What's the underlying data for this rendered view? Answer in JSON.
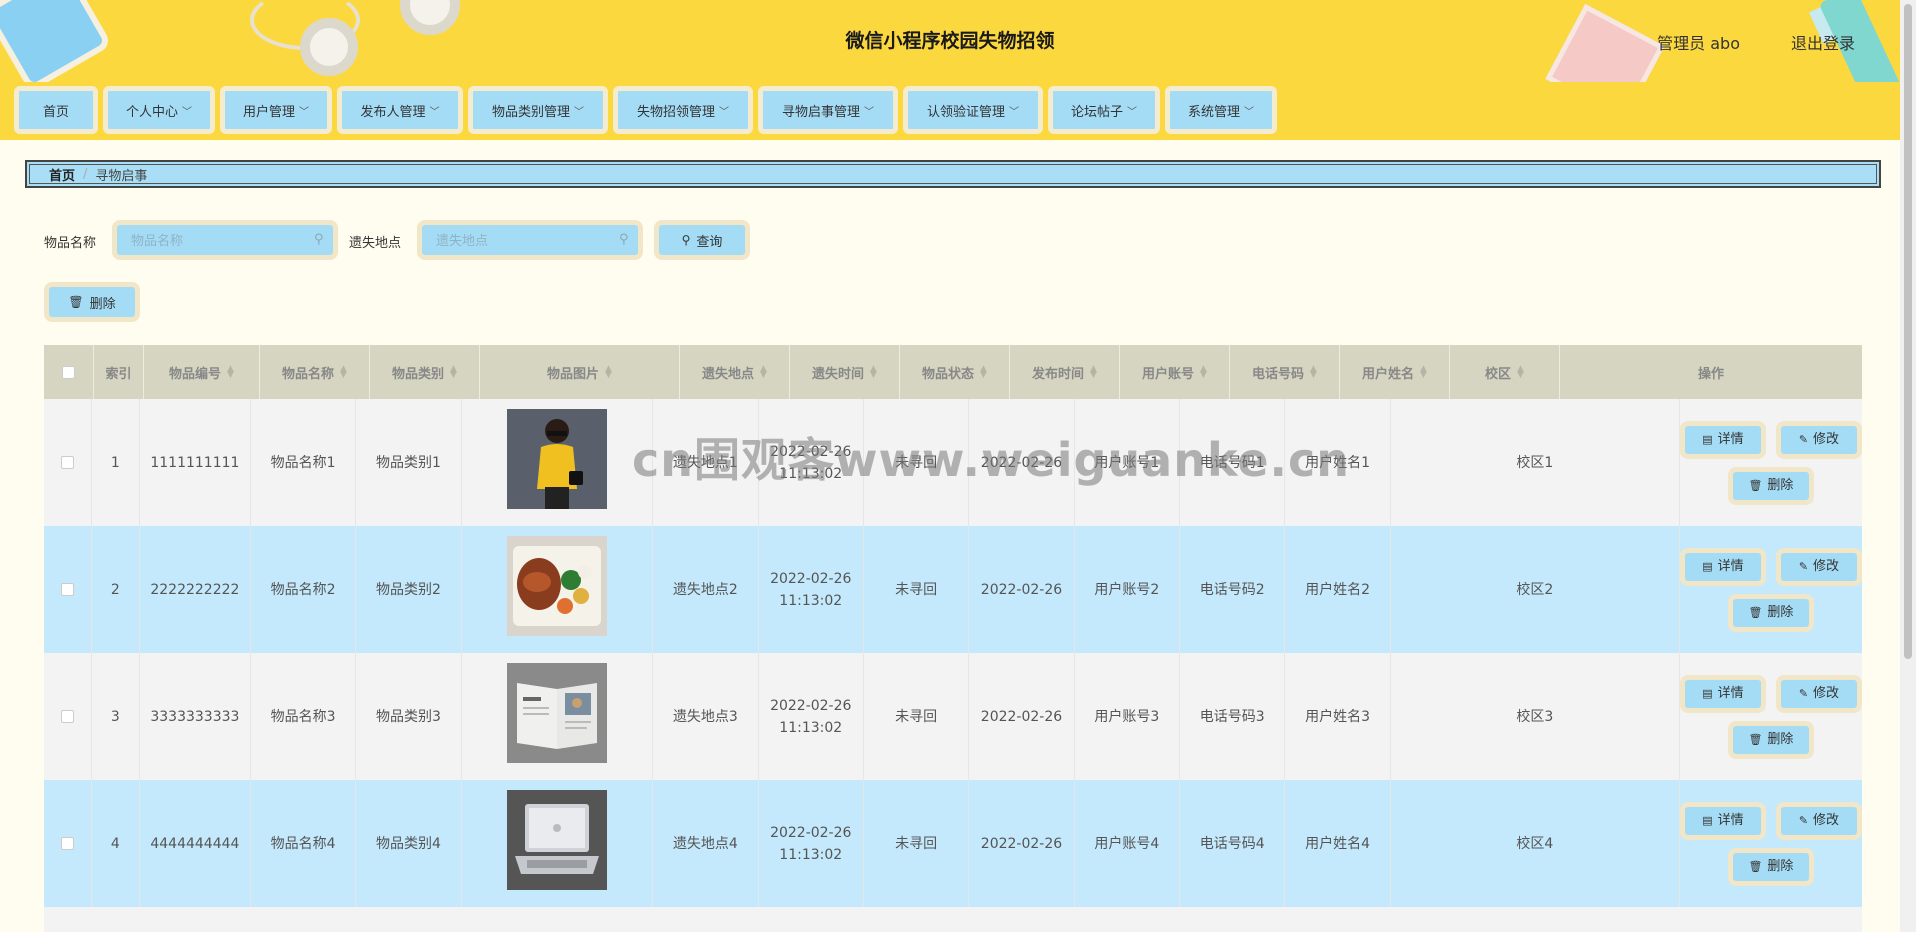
{
  "header": {
    "title": "微信小程序校园失物招领",
    "admin_label": "管理员 abo",
    "logout_label": "退出登录"
  },
  "nav": {
    "items": [
      {
        "label": "首页",
        "dropdown": false
      },
      {
        "label": "个人中心",
        "dropdown": true
      },
      {
        "label": "用户管理",
        "dropdown": true
      },
      {
        "label": "发布人管理",
        "dropdown": true
      },
      {
        "label": "物品类别管理",
        "dropdown": true
      },
      {
        "label": "失物招领管理",
        "dropdown": true
      },
      {
        "label": "寻物启事管理",
        "dropdown": true
      },
      {
        "label": "认领验证管理",
        "dropdown": true
      },
      {
        "label": "论坛帖子",
        "dropdown": true
      },
      {
        "label": "系统管理",
        "dropdown": true
      }
    ]
  },
  "breadcrumb": {
    "home": "首页",
    "separator": "/",
    "current": "寻物启事"
  },
  "search": {
    "name_label": "物品名称",
    "name_placeholder": "物品名称",
    "place_label": "遗失地点",
    "place_placeholder": "遗失地点",
    "query_label": "查询",
    "delete_label": "删除"
  },
  "table": {
    "columns": [
      "索引",
      "物品编号",
      "物品名称",
      "物品类别",
      "物品图片",
      "遗失地点",
      "遗失时间",
      "物品状态",
      "发布时间",
      "用户账号",
      "电话号码",
      "用户姓名",
      "校区",
      "操作"
    ],
    "rows": [
      {
        "index": "1",
        "code": "1111111111",
        "name": "物品名称1",
        "category": "物品类别1",
        "image": "woman-yellow-top",
        "place": "遗失地点1",
        "lost_date": "2022-02-26",
        "lost_time": "11:13:02",
        "status": "未寻回",
        "publish": "2022-02-26",
        "account": "用户账号1",
        "phone": "电话号码1",
        "username": "用户姓名1",
        "campus": "校区1"
      },
      {
        "index": "2",
        "code": "2222222222",
        "name": "物品名称2",
        "category": "物品类别2",
        "image": "bento-food",
        "place": "遗失地点2",
        "lost_date": "2022-02-26",
        "lost_time": "11:13:02",
        "status": "未寻回",
        "publish": "2022-02-26",
        "account": "用户账号2",
        "phone": "电话号码2",
        "username": "用户姓名2",
        "campus": "校区2"
      },
      {
        "index": "3",
        "code": "3333333333",
        "name": "物品名称3",
        "category": "物品类别3",
        "image": "open-magazine",
        "place": "遗失地点3",
        "lost_date": "2022-02-26",
        "lost_time": "11:13:02",
        "status": "未寻回",
        "publish": "2022-02-26",
        "account": "用户账号3",
        "phone": "电话号码3",
        "username": "用户姓名3",
        "campus": "校区3"
      },
      {
        "index": "4",
        "code": "4444444444",
        "name": "物品名称4",
        "category": "物品类别4",
        "image": "laptop",
        "place": "遗失地点4",
        "lost_date": "2022-02-26",
        "lost_time": "11:13:02",
        "status": "未寻回",
        "publish": "2022-02-26",
        "account": "用户账号4",
        "phone": "电话号码4",
        "username": "用户姓名4",
        "campus": "校区4"
      }
    ],
    "actions": {
      "detail": "详情",
      "edit": "修改",
      "delete": "删除"
    }
  },
  "watermark": "cn围观客www.weiguanke.cn",
  "colors": {
    "header_bg": "#fcd83f",
    "button_bg": "#a4dcf5",
    "button_border": "#f2e6c8",
    "row_alt_bg": "#c4e9fc",
    "table_header_bg": "#d5d5c2"
  }
}
